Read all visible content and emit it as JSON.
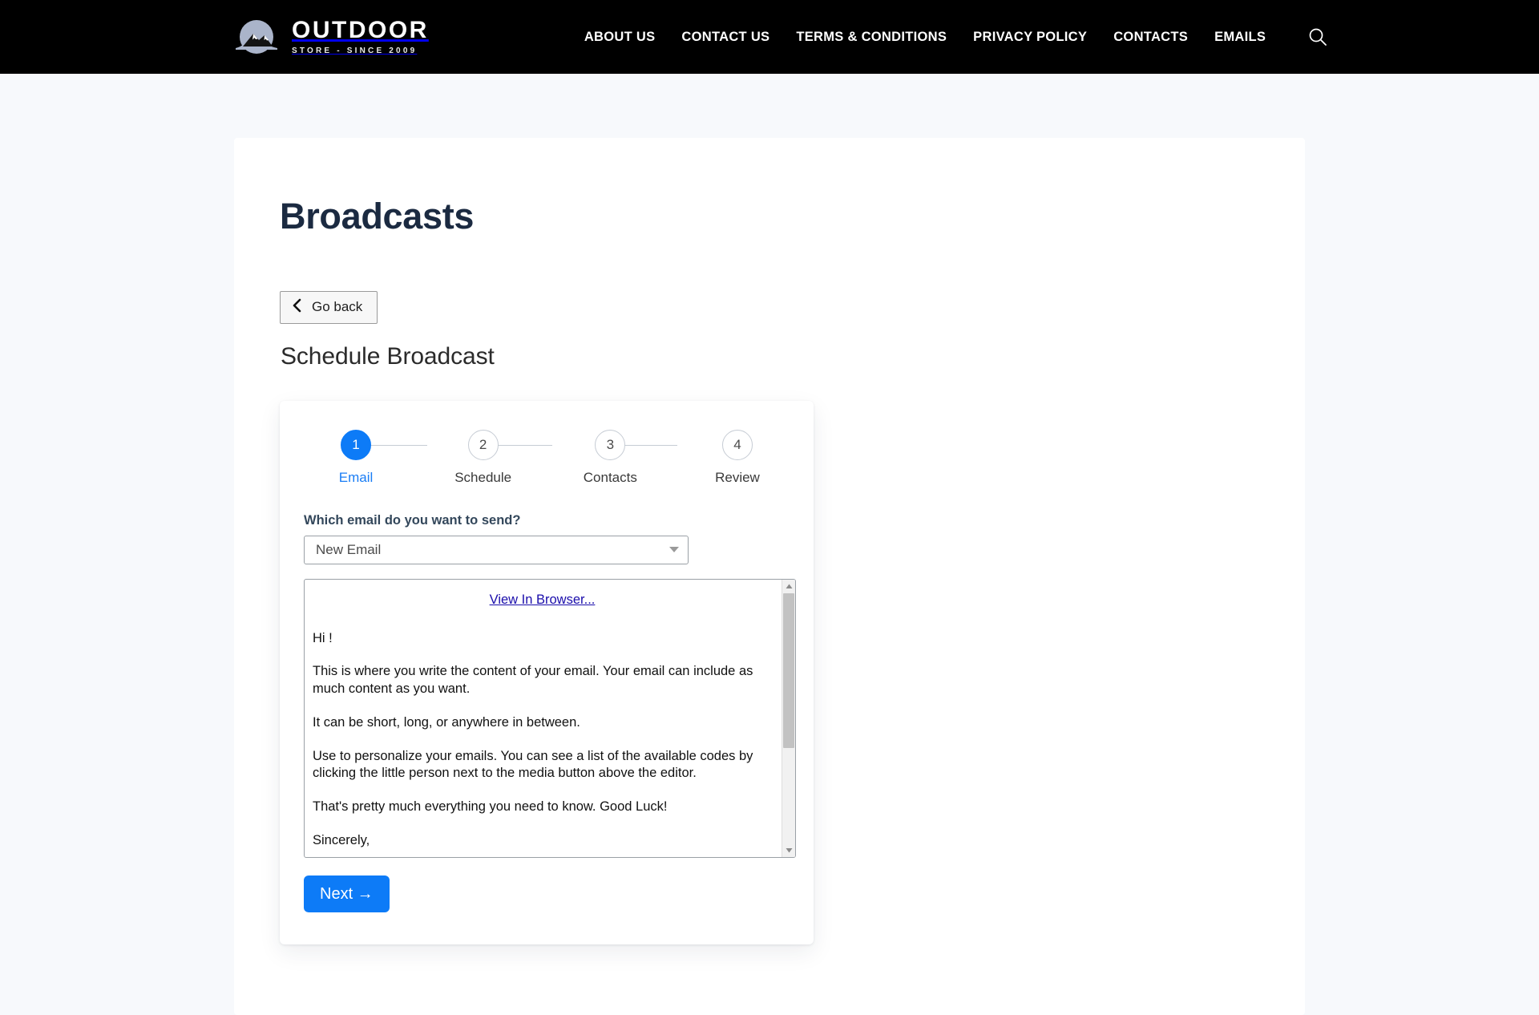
{
  "header": {
    "logo": {
      "icon": "mountain-circle-logo",
      "title": "OUTDOOR",
      "subtitle": "STORE - SINCE 2009"
    },
    "nav_items": [
      {
        "label": "ABOUT US"
      },
      {
        "label": "CONTACT US"
      },
      {
        "label": "TERMS & CONDITIONS"
      },
      {
        "label": "PRIVACY POLICY"
      },
      {
        "label": "CONTACTS"
      },
      {
        "label": "EMAILS"
      }
    ],
    "search_icon": "search-icon"
  },
  "page": {
    "title": "Broadcasts",
    "go_back_label": "Go back",
    "section_title": "Schedule Broadcast"
  },
  "stepper": {
    "steps": [
      {
        "number": "1",
        "label": "Email",
        "active": true
      },
      {
        "number": "2",
        "label": "Schedule",
        "active": false
      },
      {
        "number": "3",
        "label": "Contacts",
        "active": false
      },
      {
        "number": "4",
        "label": "Review",
        "active": false
      }
    ]
  },
  "form": {
    "email_select_label": "Which email do you want to send?",
    "email_select_value": "New Email",
    "email_select_options": [
      "New Email"
    ],
    "next_button_label": "Next →"
  },
  "email_preview": {
    "view_in_browser": "View In Browser...",
    "greeting": "Hi !",
    "paragraphs": [
      "This is where you write the content of your email. Your email can include as much content as you want.",
      "It can be short, long, or anywhere in between.",
      "Use to personalize your emails. You can see a list of the available codes by clicking the little person next to the media button above the editor.",
      "That's pretty much everything you need to know. Good Luck!",
      "Sincerely,"
    ]
  },
  "colors": {
    "navbar_bg": "#000000",
    "page_bg": "#f7f9fc",
    "accent_blue": "#0d7bf7",
    "title_navy": "#1b2a41",
    "link_blue": "#1a0dab"
  }
}
